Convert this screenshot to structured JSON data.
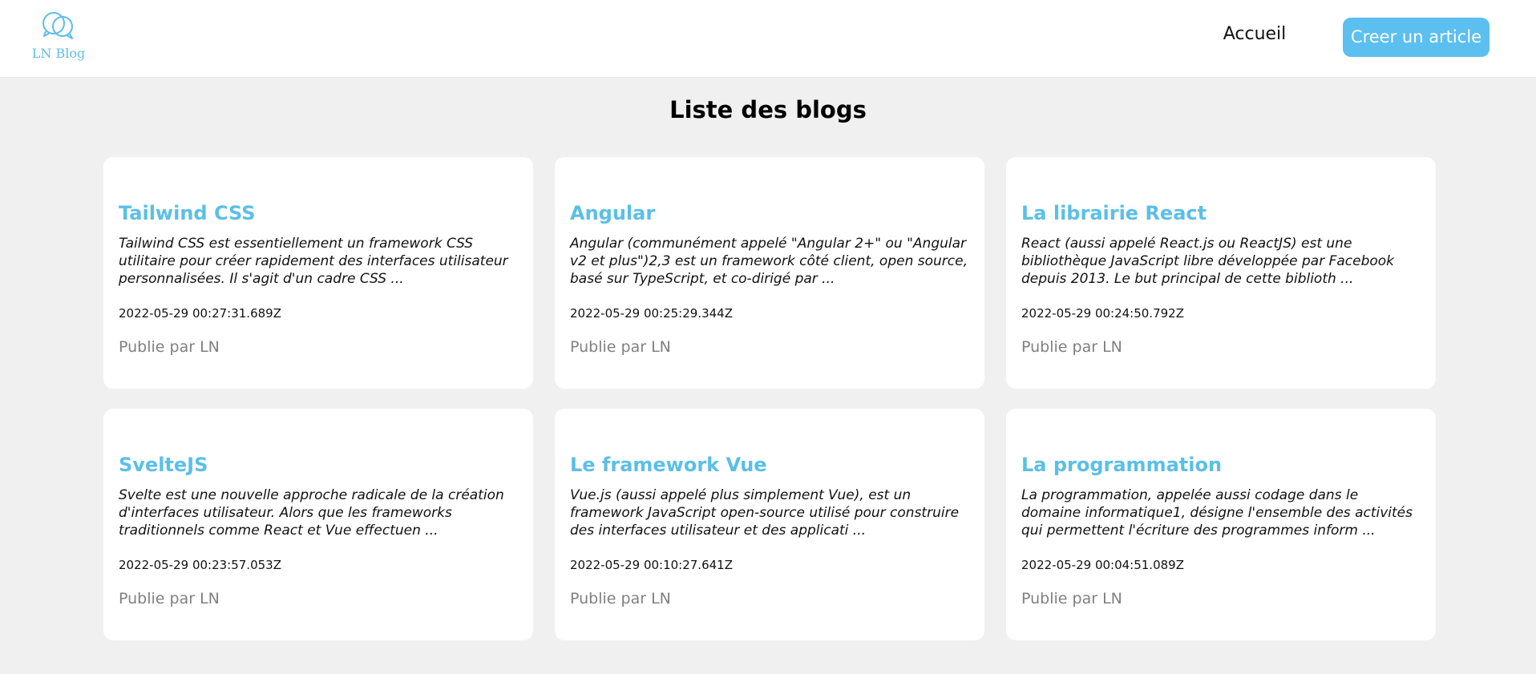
{
  "header": {
    "logo_text": "LN Blog",
    "nav_home": "Accueil",
    "create_button": "Creer un article"
  },
  "main": {
    "title": "Liste des blogs",
    "posts": [
      {
        "title": "Tailwind CSS",
        "excerpt": "Tailwind CSS est essentiellement un framework CSS utilitaire pour créer rapidement des interfaces utilisateur personnalisées. Il s'agit d'un cadre CSS ...",
        "date": "2022-05-29 00:27:31.689Z",
        "author": "Publie par LN"
      },
      {
        "title": "Angular",
        "excerpt": "Angular (communément appelé \"Angular 2+\" ou \"Angular v2 et plus\")2,3 est un framework côté client, open source, basé sur TypeScript, et co-dirigé par ...",
        "date": "2022-05-29 00:25:29.344Z",
        "author": "Publie par LN"
      },
      {
        "title": "La librairie React",
        "excerpt": "React (aussi appelé React.js ou ReactJS) est une bibliothèque JavaScript libre développée par Facebook depuis 2013. Le but principal de cette biblioth ...",
        "date": "2022-05-29 00:24:50.792Z",
        "author": "Publie par LN"
      },
      {
        "title": "SvelteJS",
        "excerpt": "Svelte est une nouvelle approche radicale de la création d'interfaces utilisateur. Alors que les frameworks traditionnels comme React et Vue effectuen ...",
        "date": "2022-05-29 00:23:57.053Z",
        "author": "Publie par LN"
      },
      {
        "title": "Le framework Vue",
        "excerpt": "Vue.js (aussi appelé plus simplement Vue), est un framework JavaScript open-source utilisé pour construire des interfaces utilisateur et des applicati ...",
        "date": "2022-05-29 00:10:27.641Z",
        "author": "Publie par LN"
      },
      {
        "title": "La programmation",
        "excerpt": "La programmation, appelée aussi codage dans le domaine informatique1, désigne l'ensemble des activités qui permettent l'écriture des programmes inform ...",
        "date": "2022-05-29 00:04:51.089Z",
        "author": "Publie par LN"
      }
    ]
  },
  "colors": {
    "accent": "#5bbfe6",
    "button": "#5bbff0",
    "background": "#f1f0f1",
    "card": "#ffffff",
    "muted": "#808080"
  }
}
